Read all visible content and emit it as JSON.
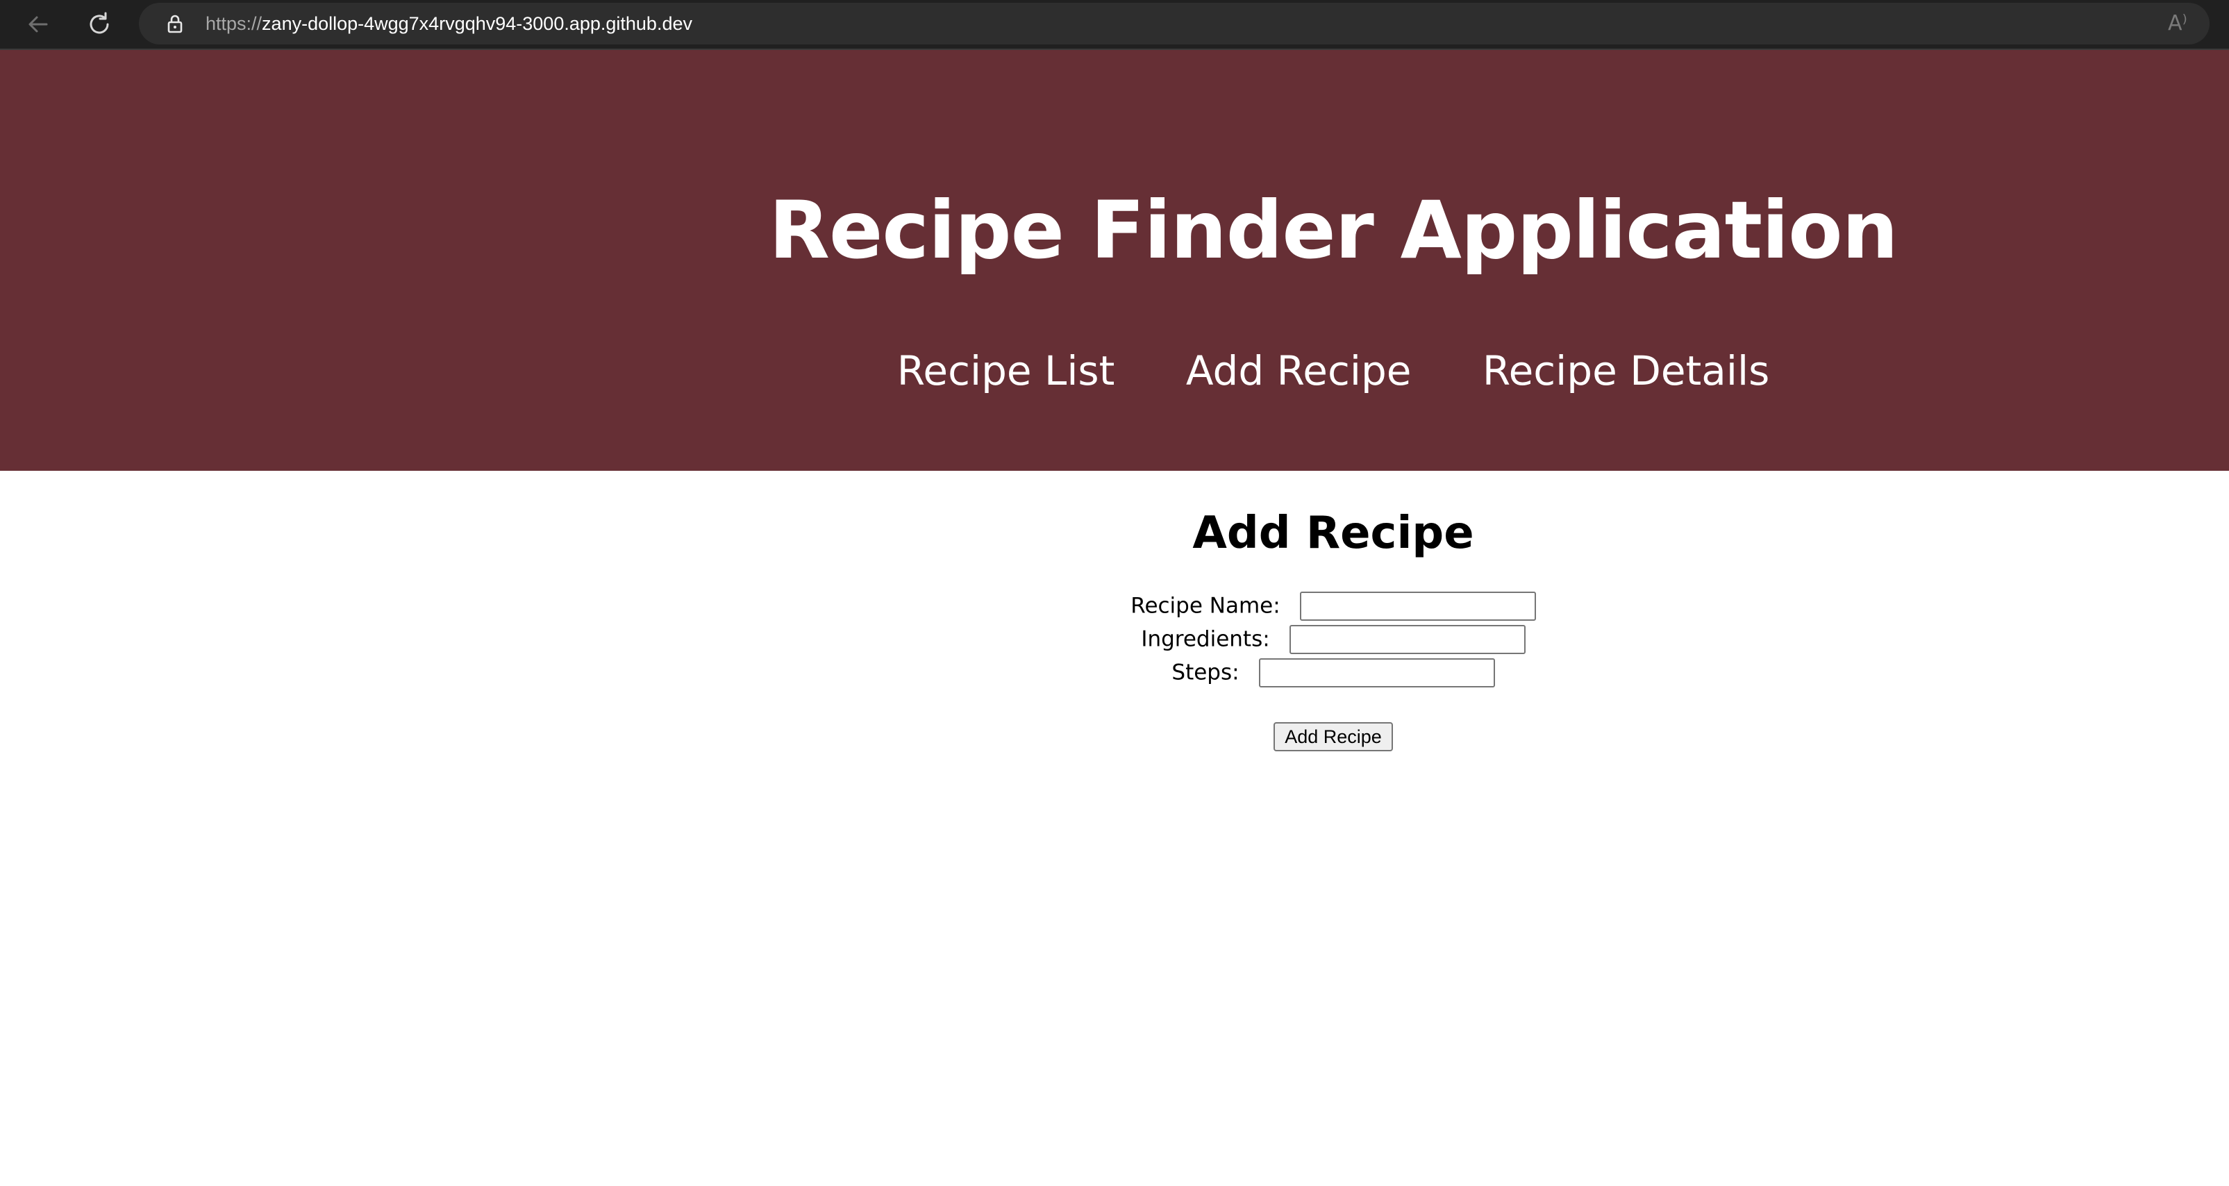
{
  "browser": {
    "url_scheme": "https://",
    "url_host": "zany-dollop-4wgg7x4rvgqhv94-3000.app.github.dev",
    "icons": {
      "back": "arrow-left-icon",
      "reload": "reload-icon",
      "lock": "lock-icon",
      "read_aloud": "read-aloud-icon"
    },
    "read_aloud_glyph": "A⁾"
  },
  "header": {
    "title": "Recipe Finder Application",
    "background_color": "#662f35",
    "nav": [
      {
        "label": "Recipe List"
      },
      {
        "label": "Add Recipe"
      },
      {
        "label": "Recipe Details"
      }
    ]
  },
  "form": {
    "title": "Add Recipe",
    "fields": [
      {
        "label": "Recipe Name:",
        "value": "",
        "placeholder": ""
      },
      {
        "label": "Ingredients:",
        "value": "",
        "placeholder": ""
      },
      {
        "label": "Steps:",
        "value": "",
        "placeholder": ""
      }
    ],
    "submit_label": "Add Recipe"
  }
}
